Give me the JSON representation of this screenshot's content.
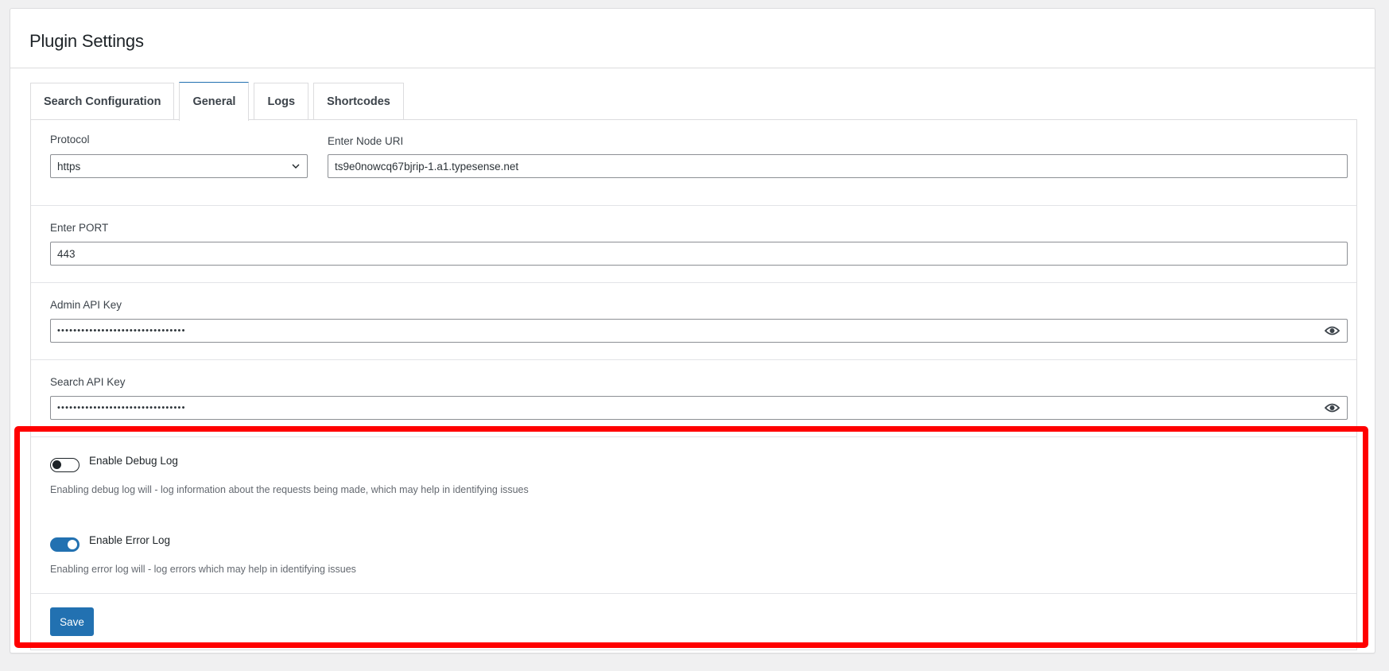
{
  "page": {
    "title": "Plugin Settings"
  },
  "tabs": [
    {
      "label": "Search Configuration",
      "active": false
    },
    {
      "label": "General",
      "active": true
    },
    {
      "label": "Logs",
      "active": false
    },
    {
      "label": "Shortcodes",
      "active": false
    }
  ],
  "general": {
    "protocol": {
      "label": "Protocol",
      "selected": "https"
    },
    "node_uri": {
      "label": "Enter Node URI",
      "value": "ts9e0nowcq67bjrip-1.a1.typesense.net"
    },
    "port": {
      "label": "Enter PORT",
      "value": "443"
    },
    "admin_api_key": {
      "label": "Admin API Key",
      "masked_value": "••••••••••••••••••••••••••••••••",
      "icon": "eye-icon"
    },
    "search_api_key": {
      "label": "Search API Key",
      "masked_value": "••••••••••••••••••••••••••••••••",
      "icon": "eye-icon"
    },
    "debug_log": {
      "label": "Enable Debug Log",
      "enabled": false,
      "description": "Enabling debug log will - log information about the requests being made, which may help in identifying issues"
    },
    "error_log": {
      "label": "Enable Error Log",
      "enabled": true,
      "description": "Enabling error log will - log errors which may help in identifying issues"
    },
    "save_label": "Save"
  },
  "colors": {
    "accent": "#2271b1",
    "highlight": "#ff0000",
    "background": "#f0f0f1"
  }
}
